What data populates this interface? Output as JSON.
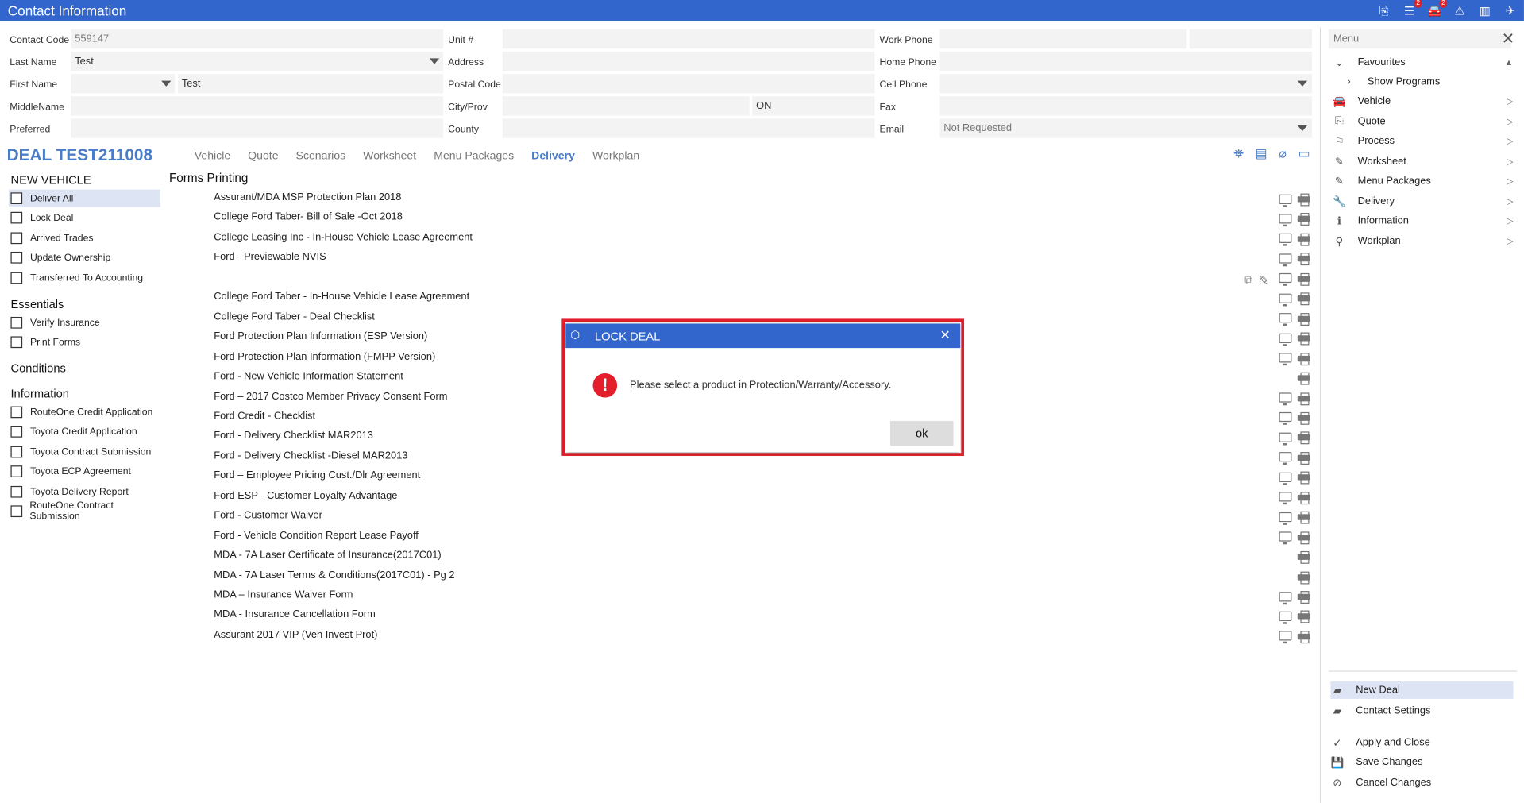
{
  "window": {
    "title": "Contact Information",
    "alert_badge": "2",
    "car_badge": "2"
  },
  "contact": {
    "code_label": "Contact Code",
    "code_value": "559147",
    "last_label": "Last Name",
    "last_value": "Test",
    "first_label": "First Name",
    "first_value": "Test",
    "middle_label": "MiddleName",
    "preferred_label": "Preferred",
    "unit_label": "Unit #",
    "address_label": "Address",
    "postal_label": "Postal Code",
    "city_label": "City/Prov",
    "prov_value": "ON",
    "county_label": "County",
    "work_label": "Work Phone",
    "home_label": "Home Phone",
    "cell_label": "Cell Phone",
    "fax_label": "Fax",
    "email_label": "Email",
    "email_value": "Not Requested"
  },
  "deal": {
    "title": "DEAL TEST211008",
    "tabs": [
      "Vehicle",
      "Quote",
      "Scenarios",
      "Worksheet",
      "Menu Packages",
      "Delivery",
      "Workplan"
    ],
    "active_tab": "Delivery"
  },
  "left": {
    "sections": [
      {
        "title": "NEW VEHICLE",
        "items": [
          "Deliver All",
          "Lock Deal",
          "Arrived Trades",
          "Update Ownership",
          "Transferred To Accounting"
        ]
      },
      {
        "title": "Essentials",
        "items": [
          "Verify Insurance",
          "Print Forms"
        ]
      },
      {
        "title": "Conditions",
        "items": []
      },
      {
        "title": "Information",
        "items": [
          "RouteOne Credit Application",
          "Toyota Credit Application",
          "Toyota Contract Submission",
          "Toyota ECP Agreement",
          "Toyota Delivery Report",
          "RouteOne Contract Submission"
        ]
      }
    ]
  },
  "forms": {
    "heading": "Forms Printing",
    "items": [
      "Assurant/MDA MSP Protection Plan 2018",
      "College Ford Taber- Bill of Sale -Oct 2018",
      "College Leasing Inc - In-House Vehicle Lease Agreement",
      "Ford - Previewable NVIS",
      "",
      "College Ford Taber - In-House Vehicle Lease Agreement",
      "College Ford Taber - Deal Checklist",
      "Ford Protection Plan Information (ESP Version)",
      "Ford Protection Plan Information (FMPP Version)",
      "Ford - New Vehicle Information Statement",
      "Ford – 2017 Costco Member Privacy Consent Form",
      "Ford Credit - Checklist",
      "Ford -  Delivery Checklist MAR2013",
      "Ford - Delivery Checklist -Diesel MAR2013",
      "Ford – Employee Pricing Cust./Dlr Agreement",
      "Ford ESP - Customer Loyalty Advantage",
      "Ford - Customer Waiver",
      "Ford - Vehicle Condition Report Lease Payoff",
      "MDA - 7A Laser Certificate of Insurance(2017C01)",
      "MDA - 7A Laser Terms & Conditions(2017C01) - Pg 2",
      "MDA – Insurance Waiver Form",
      "MDA - Insurance Cancellation Form",
      "Assurant 2017 VIP (Veh Invest Prot)"
    ]
  },
  "menu": {
    "search_placeholder": "Menu",
    "items": [
      {
        "label": "Favourites",
        "icon": "chevron-down-icon"
      },
      {
        "label": "Show Programs",
        "icon": "chevron-right-icon"
      },
      {
        "label": "Vehicle",
        "icon": "car-icon"
      },
      {
        "label": "Quote",
        "icon": "document-icon"
      },
      {
        "label": "Process",
        "icon": "signpost-icon"
      },
      {
        "label": "Worksheet",
        "icon": "pencil-icon"
      },
      {
        "label": "Menu Packages",
        "icon": "pencil-icon"
      },
      {
        "label": "Delivery",
        "icon": "wrench-icon"
      },
      {
        "label": "Information",
        "icon": "info-icon"
      },
      {
        "label": "Workplan",
        "icon": "person-icon"
      }
    ],
    "bottom": [
      {
        "label": "New Deal",
        "icon": "folder-icon"
      },
      {
        "label": "Contact Settings",
        "icon": "folder-icon"
      },
      {
        "label": "Apply and Close",
        "icon": "check-icon"
      },
      {
        "label": "Save Changes",
        "icon": "save-icon"
      },
      {
        "label": "Cancel Changes",
        "icon": "cancel-icon"
      }
    ]
  },
  "modal": {
    "title": "LOCK DEAL",
    "message": "Please select a product in Protection/Warranty/Accessory.",
    "ok_label": "ok",
    "highlight_color": "#e41e2b"
  }
}
